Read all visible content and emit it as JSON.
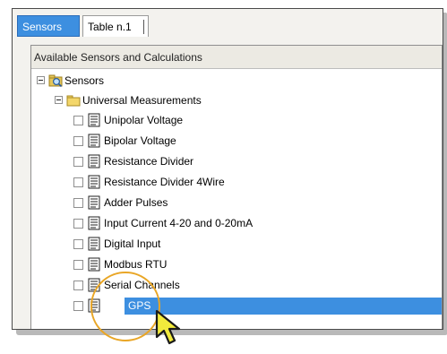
{
  "tabs": [
    {
      "label": "Sensors",
      "active": true
    },
    {
      "label": "Table n.1",
      "active": false
    }
  ],
  "panel": {
    "header": "Available Sensors and Calculations"
  },
  "tree": {
    "root": {
      "label": "Sensors",
      "icon": "sensors-folder-icon"
    },
    "group": {
      "label": "Universal Measurements",
      "icon": "folder-icon"
    },
    "items": [
      {
        "label": "Unipolar Voltage"
      },
      {
        "label": "Bipolar Voltage"
      },
      {
        "label": "Resistance Divider"
      },
      {
        "label": "Resistance Divider 4Wire"
      },
      {
        "label": "Adder Pulses"
      },
      {
        "label": "Input Current 4-20 and 0-20mA"
      },
      {
        "label": "Digital Input"
      },
      {
        "label": "Modbus RTU"
      },
      {
        "label": "Serial Channels"
      },
      {
        "label": "GPS",
        "selected": true
      }
    ]
  },
  "colors": {
    "selection": "#3d8fe0",
    "highlight_circle": "#e9a626",
    "pointer": "#f2ea3c"
  }
}
